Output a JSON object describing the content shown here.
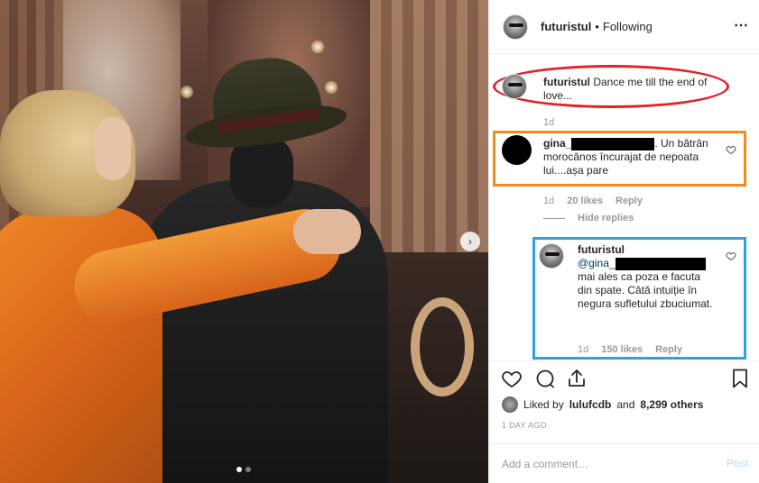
{
  "header": {
    "username": "futuristul",
    "separator": "•",
    "follow_status": "Following",
    "more_icon": "⋯"
  },
  "caption": {
    "username": "futuristul",
    "text": "Dance me till the end of love...",
    "time": "1d"
  },
  "comments": [
    {
      "username": "gina_",
      "text": ". Un bătrân morocănos încurajat de nepoata lui....așa pare",
      "time": "1d",
      "likes": "20 likes",
      "reply": "Reply",
      "hide_replies": "Hide replies"
    },
    {
      "username": "futuristul",
      "mention": "@gina_",
      "text": "mai ales ca poza e facuta din spate. Câtă intuiție în negura sufletului zbuciumat.",
      "time": "1d",
      "likes": "150 likes",
      "reply": "Reply"
    }
  ],
  "icons": {
    "like": "heart-icon",
    "comment": "comment-icon",
    "share": "share-icon",
    "save": "bookmark-icon",
    "next": "chevron-right-icon"
  },
  "liked_by": {
    "prefix": "Liked by",
    "user": "lulufcdb",
    "and": "and",
    "others": "8,299 others"
  },
  "time_ago": "1 DAY AGO",
  "add_comment": {
    "placeholder": "Add a comment…",
    "post_label": "Post"
  },
  "colors": {
    "red_highlight": "#e2202a",
    "orange_highlight": "#f28a1c",
    "blue_highlight": "#2aa3e0",
    "post_disabled": "#b3dbff"
  },
  "carousel": {
    "current": 1,
    "total": 2
  }
}
